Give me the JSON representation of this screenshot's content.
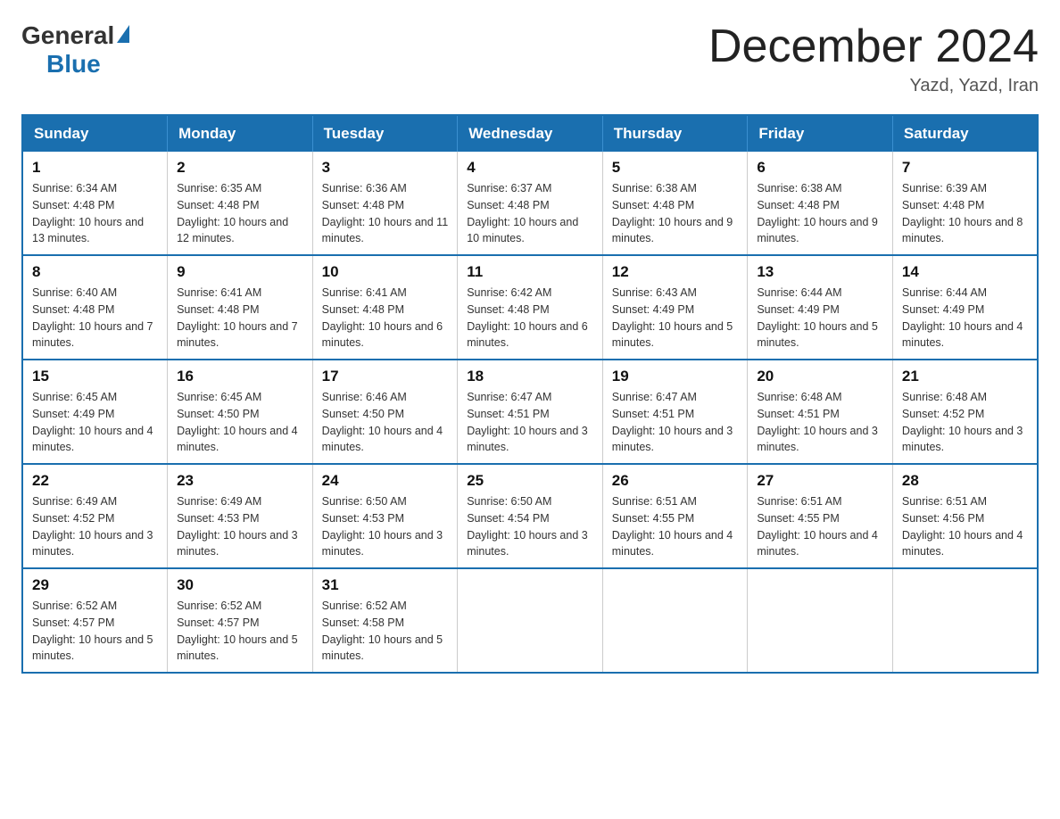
{
  "logo": {
    "general": "General",
    "blue": "Blue"
  },
  "title": "December 2024",
  "location": "Yazd, Yazd, Iran",
  "days_of_week": [
    "Sunday",
    "Monday",
    "Tuesday",
    "Wednesday",
    "Thursday",
    "Friday",
    "Saturday"
  ],
  "weeks": [
    [
      {
        "day": "1",
        "sunrise": "6:34 AM",
        "sunset": "4:48 PM",
        "daylight": "10 hours and 13 minutes."
      },
      {
        "day": "2",
        "sunrise": "6:35 AM",
        "sunset": "4:48 PM",
        "daylight": "10 hours and 12 minutes."
      },
      {
        "day": "3",
        "sunrise": "6:36 AM",
        "sunset": "4:48 PM",
        "daylight": "10 hours and 11 minutes."
      },
      {
        "day": "4",
        "sunrise": "6:37 AM",
        "sunset": "4:48 PM",
        "daylight": "10 hours and 10 minutes."
      },
      {
        "day": "5",
        "sunrise": "6:38 AM",
        "sunset": "4:48 PM",
        "daylight": "10 hours and 9 minutes."
      },
      {
        "day": "6",
        "sunrise": "6:38 AM",
        "sunset": "4:48 PM",
        "daylight": "10 hours and 9 minutes."
      },
      {
        "day": "7",
        "sunrise": "6:39 AM",
        "sunset": "4:48 PM",
        "daylight": "10 hours and 8 minutes."
      }
    ],
    [
      {
        "day": "8",
        "sunrise": "6:40 AM",
        "sunset": "4:48 PM",
        "daylight": "10 hours and 7 minutes."
      },
      {
        "day": "9",
        "sunrise": "6:41 AM",
        "sunset": "4:48 PM",
        "daylight": "10 hours and 7 minutes."
      },
      {
        "day": "10",
        "sunrise": "6:41 AM",
        "sunset": "4:48 PM",
        "daylight": "10 hours and 6 minutes."
      },
      {
        "day": "11",
        "sunrise": "6:42 AM",
        "sunset": "4:48 PM",
        "daylight": "10 hours and 6 minutes."
      },
      {
        "day": "12",
        "sunrise": "6:43 AM",
        "sunset": "4:49 PM",
        "daylight": "10 hours and 5 minutes."
      },
      {
        "day": "13",
        "sunrise": "6:44 AM",
        "sunset": "4:49 PM",
        "daylight": "10 hours and 5 minutes."
      },
      {
        "day": "14",
        "sunrise": "6:44 AM",
        "sunset": "4:49 PM",
        "daylight": "10 hours and 4 minutes."
      }
    ],
    [
      {
        "day": "15",
        "sunrise": "6:45 AM",
        "sunset": "4:49 PM",
        "daylight": "10 hours and 4 minutes."
      },
      {
        "day": "16",
        "sunrise": "6:45 AM",
        "sunset": "4:50 PM",
        "daylight": "10 hours and 4 minutes."
      },
      {
        "day": "17",
        "sunrise": "6:46 AM",
        "sunset": "4:50 PM",
        "daylight": "10 hours and 4 minutes."
      },
      {
        "day": "18",
        "sunrise": "6:47 AM",
        "sunset": "4:51 PM",
        "daylight": "10 hours and 3 minutes."
      },
      {
        "day": "19",
        "sunrise": "6:47 AM",
        "sunset": "4:51 PM",
        "daylight": "10 hours and 3 minutes."
      },
      {
        "day": "20",
        "sunrise": "6:48 AM",
        "sunset": "4:51 PM",
        "daylight": "10 hours and 3 minutes."
      },
      {
        "day": "21",
        "sunrise": "6:48 AM",
        "sunset": "4:52 PM",
        "daylight": "10 hours and 3 minutes."
      }
    ],
    [
      {
        "day": "22",
        "sunrise": "6:49 AM",
        "sunset": "4:52 PM",
        "daylight": "10 hours and 3 minutes."
      },
      {
        "day": "23",
        "sunrise": "6:49 AM",
        "sunset": "4:53 PM",
        "daylight": "10 hours and 3 minutes."
      },
      {
        "day": "24",
        "sunrise": "6:50 AM",
        "sunset": "4:53 PM",
        "daylight": "10 hours and 3 minutes."
      },
      {
        "day": "25",
        "sunrise": "6:50 AM",
        "sunset": "4:54 PM",
        "daylight": "10 hours and 3 minutes."
      },
      {
        "day": "26",
        "sunrise": "6:51 AM",
        "sunset": "4:55 PM",
        "daylight": "10 hours and 4 minutes."
      },
      {
        "day": "27",
        "sunrise": "6:51 AM",
        "sunset": "4:55 PM",
        "daylight": "10 hours and 4 minutes."
      },
      {
        "day": "28",
        "sunrise": "6:51 AM",
        "sunset": "4:56 PM",
        "daylight": "10 hours and 4 minutes."
      }
    ],
    [
      {
        "day": "29",
        "sunrise": "6:52 AM",
        "sunset": "4:57 PM",
        "daylight": "10 hours and 5 minutes."
      },
      {
        "day": "30",
        "sunrise": "6:52 AM",
        "sunset": "4:57 PM",
        "daylight": "10 hours and 5 minutes."
      },
      {
        "day": "31",
        "sunrise": "6:52 AM",
        "sunset": "4:58 PM",
        "daylight": "10 hours and 5 minutes."
      },
      null,
      null,
      null,
      null
    ]
  ],
  "labels": {
    "sunrise_prefix": "Sunrise: ",
    "sunset_prefix": "Sunset: ",
    "daylight_prefix": "Daylight: "
  }
}
